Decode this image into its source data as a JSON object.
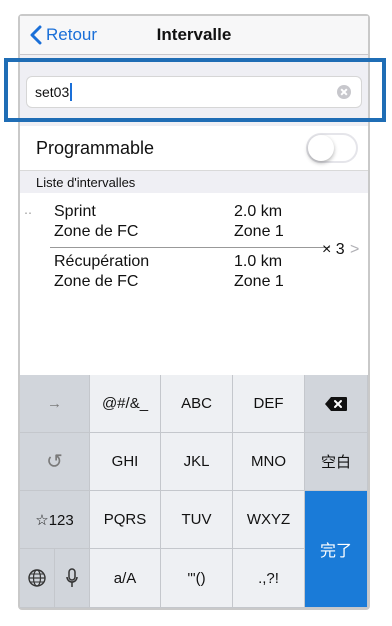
{
  "navbar": {
    "back_label": "Retour",
    "title": "Intervalle"
  },
  "name_input": {
    "value": "set03"
  },
  "programmable": {
    "label": "Programmable",
    "enabled": false
  },
  "intervals": {
    "section_title": "Liste d'intervalles",
    "items": [
      {
        "label": "Sprint",
        "value": "2.0 km"
      },
      {
        "label": "Zone de FC",
        "value": "Zone 1"
      },
      {
        "label": "Récupération",
        "value": "1.0 km"
      },
      {
        "label": "Zone de FC",
        "value": "Zone 1"
      }
    ],
    "repeat": "× 3",
    "chevron": ">"
  },
  "keyboard": {
    "keys": {
      "next": "→",
      "symbols": "@#/&_",
      "abc": "ABC",
      "def": "DEF",
      "undo": "↺",
      "ghi": "GHI",
      "jkl": "JKL",
      "mno": "MNO",
      "space": "空白",
      "num": "☆123",
      "pqrs": "PQRS",
      "tuv": "TUV",
      "wxyz": "WXYZ",
      "done": "完了",
      "case": "a/A",
      "quotes": "'\"()",
      "punct": ".,?!"
    },
    "icons": {
      "delete": "backspace-icon",
      "globe": "globe-icon",
      "mic": "microphone-icon"
    },
    "colors": {
      "done": "#1a7bd8",
      "accent": "#1a6fd8",
      "highlight": "#1f6db5"
    }
  }
}
